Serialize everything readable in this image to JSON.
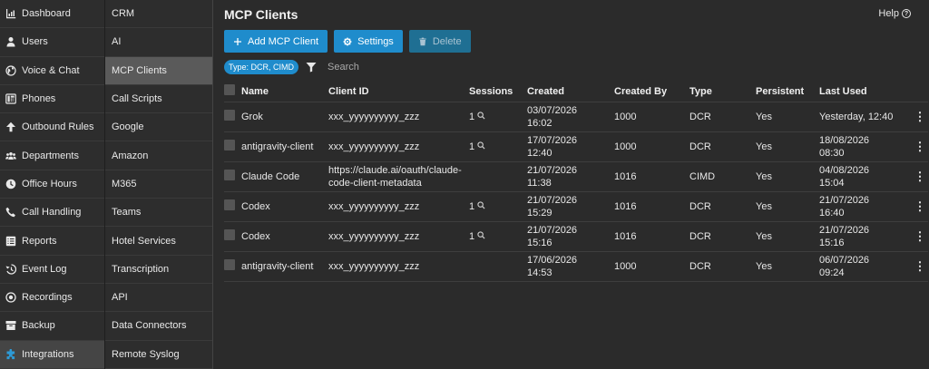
{
  "nav1": [
    {
      "label": "Dashboard",
      "icon": "dashboard-icon"
    },
    {
      "label": "Users",
      "icon": "user-icon"
    },
    {
      "label": "Voice & Chat",
      "icon": "globe-icon"
    },
    {
      "label": "Phones",
      "icon": "phone-device-icon"
    },
    {
      "label": "Outbound Rules",
      "icon": "arrow-up-icon"
    },
    {
      "label": "Departments",
      "icon": "group-icon"
    },
    {
      "label": "Office Hours",
      "icon": "clock-icon"
    },
    {
      "label": "Call Handling",
      "icon": "phone-icon"
    },
    {
      "label": "Reports",
      "icon": "list-icon"
    },
    {
      "label": "Event Log",
      "icon": "history-icon"
    },
    {
      "label": "Recordings",
      "icon": "record-icon"
    },
    {
      "label": "Backup",
      "icon": "archive-icon"
    },
    {
      "label": "Integrations",
      "icon": "puzzle-icon",
      "active": true
    }
  ],
  "nav2": [
    {
      "label": "CRM"
    },
    {
      "label": "AI"
    },
    {
      "label": "MCP Clients",
      "active": true
    },
    {
      "label": "Call Scripts"
    },
    {
      "label": "Google"
    },
    {
      "label": "Amazon"
    },
    {
      "label": "M365"
    },
    {
      "label": "Teams"
    },
    {
      "label": "Hotel Services"
    },
    {
      "label": "Transcription"
    },
    {
      "label": "API"
    },
    {
      "label": "Data Connectors"
    },
    {
      "label": "Remote Syslog"
    }
  ],
  "page": {
    "title": "MCP Clients",
    "help_label": "Help",
    "help_icon": "?"
  },
  "toolbar": {
    "add_label": "Add MCP Client",
    "settings_label": "Settings",
    "delete_label": "Delete"
  },
  "filter": {
    "chip_label": "Type: DCR, CIMD",
    "search_placeholder": "Search"
  },
  "table": {
    "columns": [
      "Name",
      "Client ID",
      "Sessions",
      "Created",
      "Created By",
      "Type",
      "Persistent",
      "Last Used"
    ],
    "rows": [
      {
        "name": "Grok",
        "client_id": "xxx_yyyyyyyyyy_zzz",
        "sessions": "1",
        "created": [
          "03/07/2026",
          "16:02"
        ],
        "created_by": "1000",
        "type": "DCR",
        "persistent": "Yes",
        "last_used": [
          "Yesterday, 12:40"
        ]
      },
      {
        "name": "antigravity-client",
        "client_id": "xxx_yyyyyyyyyy_zzz",
        "sessions": "1",
        "created": [
          "17/07/2026",
          "12:40"
        ],
        "created_by": "1000",
        "type": "DCR",
        "persistent": "Yes",
        "last_used": [
          "18/08/2026",
          "08:30"
        ]
      },
      {
        "name": "Claude Code",
        "client_id": "https://claude.ai/oauth/claude-code-client-metadata",
        "client_id_lines": [
          "https://claude.ai/oauth/claude-",
          "code-client-metadata"
        ],
        "sessions": "",
        "created": [
          "21/07/2026",
          "11:38"
        ],
        "created_by": "1016",
        "type": "CIMD",
        "persistent": "Yes",
        "last_used": [
          "04/08/2026",
          "15:04"
        ]
      },
      {
        "name": "Codex",
        "client_id": "xxx_yyyyyyyyyy_zzz",
        "sessions": "1",
        "created": [
          "21/07/2026",
          "15:29"
        ],
        "created_by": "1016",
        "type": "DCR",
        "persistent": "Yes",
        "last_used": [
          "21/07/2026",
          "16:40"
        ]
      },
      {
        "name": "Codex",
        "client_id": "xxx_yyyyyyyyyy_zzz",
        "sessions": "1",
        "created": [
          "21/07/2026",
          "15:16"
        ],
        "created_by": "1016",
        "type": "DCR",
        "persistent": "Yes",
        "last_used": [
          "21/07/2026",
          "15:16"
        ]
      },
      {
        "name": "antigravity-client",
        "client_id": "xxx_yyyyyyyyyy_zzz",
        "sessions": "",
        "created": [
          "17/06/2026",
          "14:53"
        ],
        "created_by": "1000",
        "type": "DCR",
        "persistent": "Yes",
        "last_used": [
          "06/07/2026",
          "09:24"
        ]
      }
    ]
  },
  "colors": {
    "accent": "#1f8ccc",
    "active_icon": "#2d9ad6",
    "background": "#2b2b2b"
  }
}
